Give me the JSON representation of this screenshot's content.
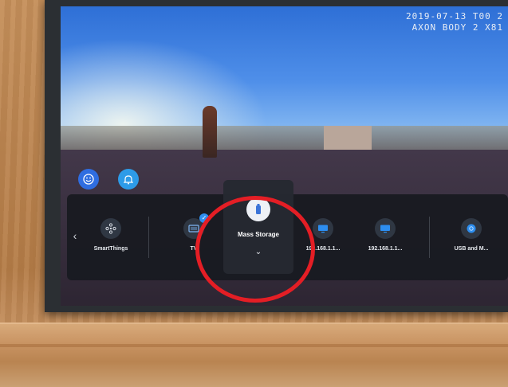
{
  "watermark": {
    "line1": "2019-07-13 T00 2",
    "line2": "AXON BODY 2 X81"
  },
  "overlay_buttons": [
    {
      "name": "smart-hub-button",
      "icon": "smiley-icon",
      "color": "#2f6de0"
    },
    {
      "name": "notifications-button",
      "icon": "bell-icon",
      "color": "#2d9be8"
    }
  ],
  "source_bar": {
    "prev_arrow": "‹",
    "items": [
      {
        "label": "SmartThings",
        "icon": "smartthings-icon"
      },
      {
        "label": "TV",
        "icon": "tv-icon",
        "checked": true
      },
      {
        "label": "Mass Storage",
        "icon": "usb-storage-icon",
        "selected": true
      },
      {
        "label": "192.168.1.1...",
        "icon": "monitor-icon"
      },
      {
        "label": "192.168.1.1...",
        "icon": "monitor-icon"
      },
      {
        "label": "USB and M...",
        "icon": "usb-media-icon"
      }
    ],
    "expand_chevron": "⌄"
  },
  "colors": {
    "accent_blue": "#2d8ef0",
    "annotation_ring": "#e41e25"
  }
}
